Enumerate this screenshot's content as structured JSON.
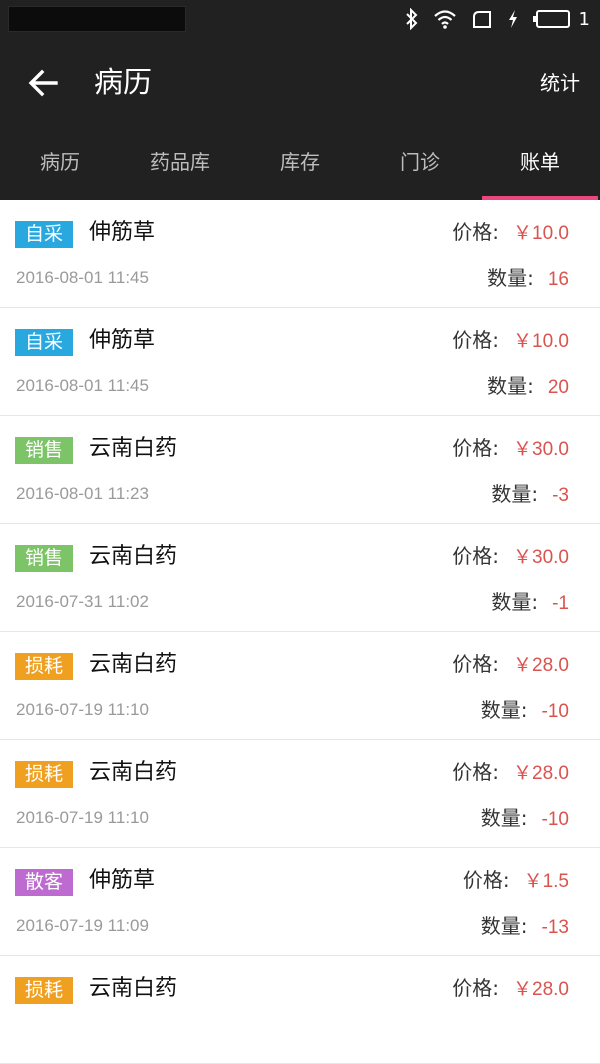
{
  "status": {
    "battery_level": "1"
  },
  "header": {
    "title": "病历",
    "action": "统计"
  },
  "tabs": [
    {
      "label": "病历"
    },
    {
      "label": "药品库"
    },
    {
      "label": "库存"
    },
    {
      "label": "门诊"
    },
    {
      "label": "账单",
      "active": true
    }
  ],
  "labels": {
    "price": "价格:",
    "qty": "数量:"
  },
  "tag_colors": {
    "自采": "#29a8e0",
    "销售": "#7cc467",
    "损耗": "#f0a020",
    "散客": "#be6bd1"
  },
  "records": [
    {
      "tag": "自采",
      "name": "伸筋草",
      "date": "2016-08-01 11:45",
      "price": "￥10.0",
      "qty": "16"
    },
    {
      "tag": "自采",
      "name": "伸筋草",
      "date": "2016-08-01 11:45",
      "price": "￥10.0",
      "qty": "20"
    },
    {
      "tag": "销售",
      "name": "云南白药",
      "date": "2016-08-01 11:23",
      "price": "￥30.0",
      "qty": "-3"
    },
    {
      "tag": "销售",
      "name": "云南白药",
      "date": "2016-07-31 11:02",
      "price": "￥30.0",
      "qty": "-1"
    },
    {
      "tag": "损耗",
      "name": "云南白药",
      "date": "2016-07-19 11:10",
      "price": "￥28.0",
      "qty": "-10"
    },
    {
      "tag": "损耗",
      "name": "云南白药",
      "date": "2016-07-19 11:10",
      "price": "￥28.0",
      "qty": "-10"
    },
    {
      "tag": "散客",
      "name": "伸筋草",
      "date": "2016-07-19 11:09",
      "price": "￥1.5",
      "qty": "-13"
    },
    {
      "tag": "损耗",
      "name": "云南白药",
      "date": "",
      "price": "￥28.0",
      "qty": ""
    }
  ]
}
